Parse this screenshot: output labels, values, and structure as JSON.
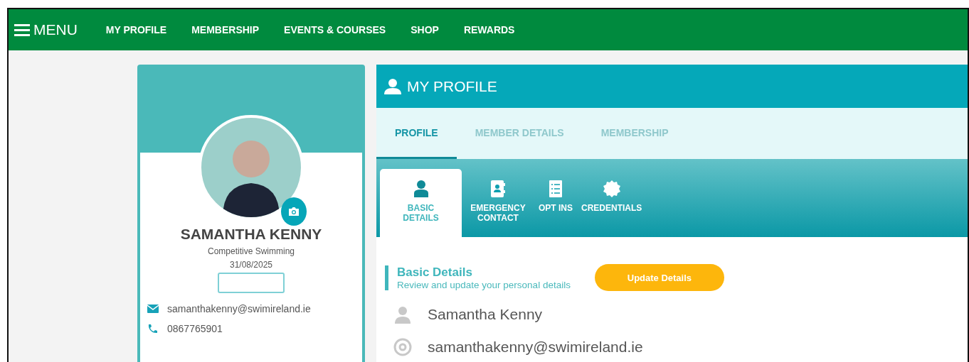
{
  "nav": {
    "menu_label": "MENU",
    "items": [
      {
        "label": "MY PROFILE"
      },
      {
        "label": "MEMBERSHIP"
      },
      {
        "label": "EVENTS & COURSES"
      },
      {
        "label": "SHOP"
      },
      {
        "label": "REWARDS"
      }
    ]
  },
  "profile_card": {
    "name": "SAMANTHA KENNY",
    "discipline": "Competitive Swimming",
    "date": "31/08/2025",
    "email": "samanthakenny@swimireland.ie",
    "phone": "0867765901"
  },
  "panel": {
    "title": "MY PROFILE",
    "tabs": [
      {
        "label": "PROFILE",
        "selected": true
      },
      {
        "label": "MEMBER DETAILS",
        "selected": false
      },
      {
        "label": "MEMBERSHIP",
        "selected": false
      }
    ],
    "subtabs": [
      {
        "label": "BASIC DETAILS",
        "kind": "person",
        "selected": true
      },
      {
        "label": "EMERGENCY CONTACT",
        "kind": "contact",
        "selected": false
      },
      {
        "label": "OPT INS",
        "kind": "checklist",
        "selected": false
      },
      {
        "label": "CREDENTIALS",
        "kind": "badge",
        "selected": false
      }
    ],
    "section": {
      "title": "Basic Details",
      "subtitle": "Review and update your personal details",
      "button": "Update Details"
    },
    "fields": [
      {
        "kind": "person",
        "value": "Samantha Kenny"
      },
      {
        "kind": "email",
        "value": "samanthakenny@swimireland.ie"
      }
    ]
  }
}
